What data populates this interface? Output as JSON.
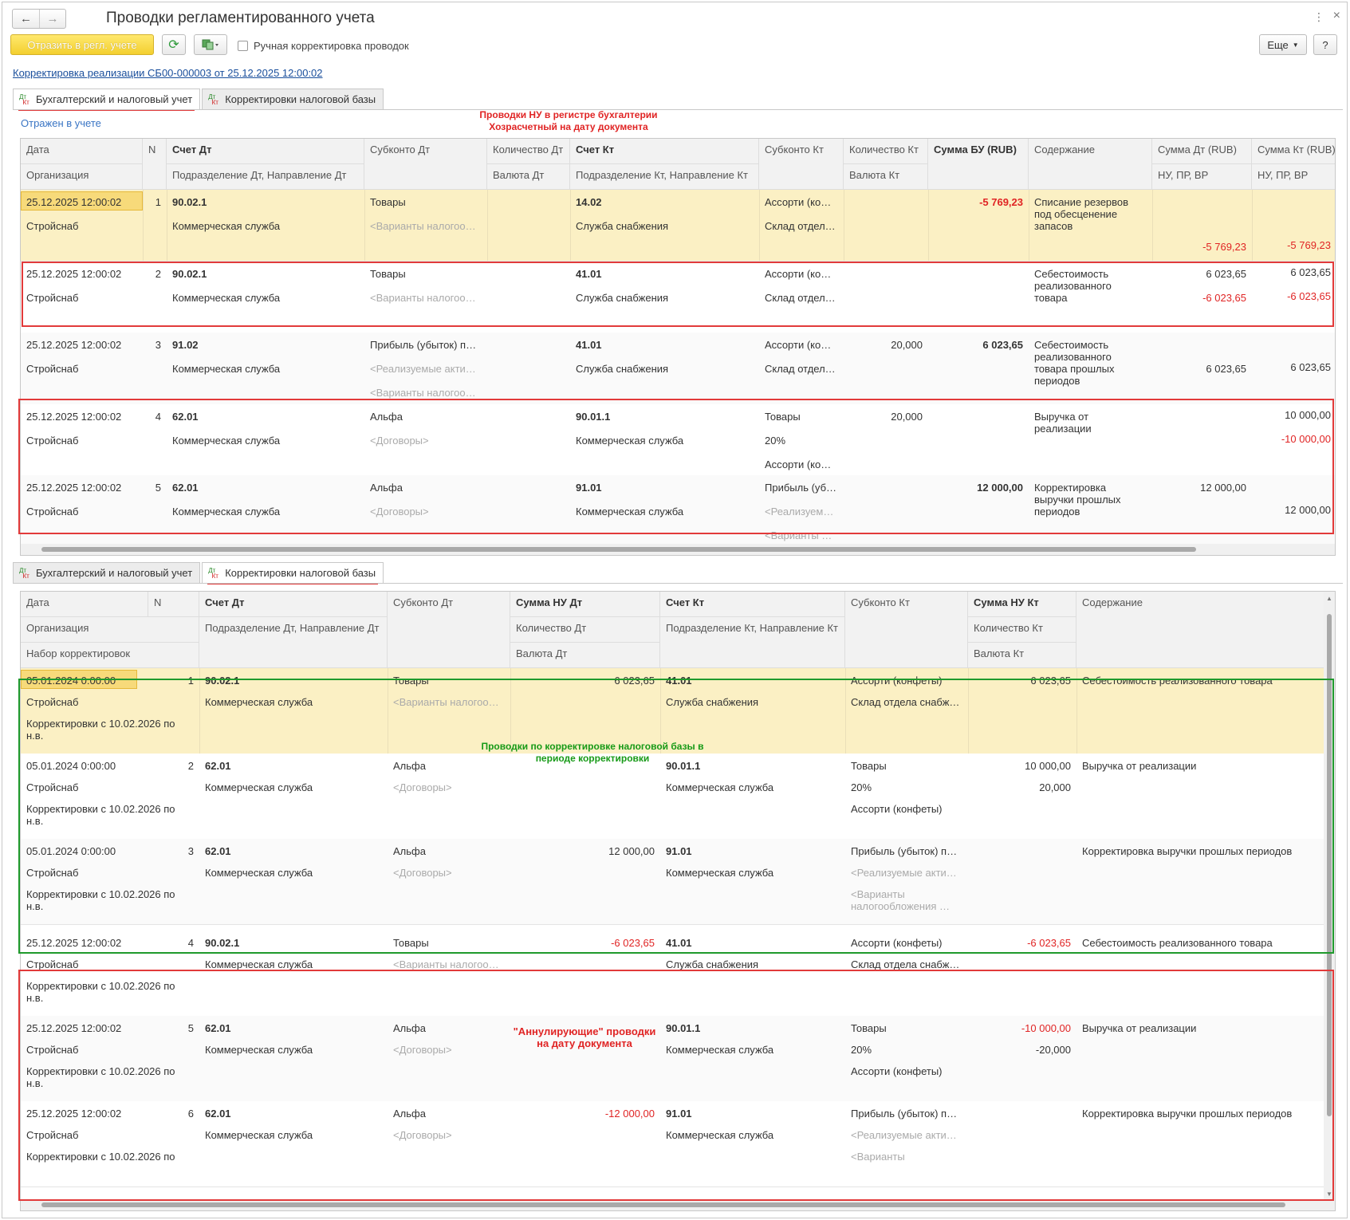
{
  "window": {
    "title": "Проводки регламентированного учета",
    "back_icon": "←",
    "forward_icon": "→",
    "menu_icon": "⋮",
    "close_icon": "×"
  },
  "toolbar": {
    "post_button": "Отразить в регл. учете",
    "refresh_icon": "⟳",
    "manual_checkbox_label": "Ручная корректировка проводок",
    "more_button": "Еще",
    "help_button": "?"
  },
  "document_link": "Корректировка реализации СБ00-000003 от 25.12.2025 12:00:02",
  "tabs": {
    "dt": "Дт",
    "kt": "Кт",
    "accounting": "Бухгалтерский и налоговый учет",
    "tax_corrections": "Корректировки налоговой базы"
  },
  "annotations": {
    "top_line1": "Проводки НУ в регистре бухгалтерии",
    "top_line2": "Хозрасчетный на дату документа",
    "green_line1": "Проводки по корректировке налоговой базы в",
    "green_line2": "периоде корректировки",
    "cancel_line1": "\"Аннулирующие\" проводки",
    "cancel_line2": "на дату документа"
  },
  "reflected_label": "Отражен в учете",
  "table1": {
    "headers": {
      "date": "Дата",
      "org": "Организация",
      "n": "N",
      "acc_dt": "Счет Дт",
      "dept_dt": "Подразделение Дт, Направление Дт",
      "sub_dt": "Субконто Дт",
      "qty_dt": "Количество Дт",
      "cur_dt": "Валюта Дт",
      "acc_kt": "Счет Кт",
      "dept_kt": "Подразделение Кт, Направление Кт",
      "sub_kt": "Субконто Кт",
      "qty_kt": "Количество Кт",
      "cur_kt": "Валюта Кт",
      "sum_bu": "Сумма БУ (RUB)",
      "content": "Содержание",
      "sum_dt": "Сумма Дт (RUB)",
      "nu_dt": "НУ, ПР, ВР",
      "sum_kt": "Сумма Кт (RUB)",
      "nu_kt": "НУ, ПР, ВР"
    },
    "rows": [
      {
        "date": "25.12.2025 12:00:02",
        "org": "Стройснаб",
        "n": "1",
        "acc_dt": "90.02.1",
        "dept_dt": "Коммерческая служба",
        "sub_dt1": "Товары",
        "sub_dt2": "<Варианты налогооб…",
        "sub_dt3": "",
        "qty_dt": "",
        "acc_kt": "14.02",
        "dept_kt": "Служба снабжения",
        "sub_kt1": "Ассорти (ко…",
        "sub_kt2": "Склад отдел…",
        "sub_kt3": "",
        "qty_kt": "",
        "sum_bu": "-5 769,23",
        "content": "Списание резервов под обесценение запасов",
        "sum_dt1": "",
        "sum_dt2": "",
        "sum_dt3": "-5 769,23",
        "sum_kt1": "",
        "sum_kt2": "",
        "sum_kt3": "-5 769,23"
      },
      {
        "date": "25.12.2025 12:00:02",
        "org": "Стройснаб",
        "n": "2",
        "acc_dt": "90.02.1",
        "dept_dt": "Коммерческая служба",
        "sub_dt1": "Товары",
        "sub_dt2": "<Варианты налогооб…",
        "sub_dt3": "",
        "qty_dt": "",
        "acc_kt": "41.01",
        "dept_kt": "Служба снабжения",
        "sub_kt1": "Ассорти (ко…",
        "sub_kt2": "Склад отдел…",
        "sub_kt3": "",
        "qty_kt": "",
        "sum_bu": "",
        "content": "Себестоимость реализованного товара",
        "sum_dt1": "6 023,65",
        "sum_dt2": "-6 023,65",
        "sum_dt3": "",
        "sum_kt1": "6 023,65",
        "sum_kt2": "-6 023,65",
        "sum_kt3": ""
      },
      {
        "date": "25.12.2025 12:00:02",
        "org": "Стройснаб",
        "n": "3",
        "acc_dt": "91.02",
        "dept_dt": "Коммерческая служба",
        "sub_dt1": "Прибыль (убыток) пр…",
        "sub_dt2": "<Реализуемые акти…",
        "sub_dt3": "<Варианты налогооб…",
        "qty_dt": "",
        "acc_kt": "41.01",
        "dept_kt": "Служба снабжения",
        "sub_kt1": "Ассорти (ко…",
        "sub_kt2": "Склад отдел…",
        "sub_kt3": "",
        "qty_kt": "20,000",
        "sum_bu": "6 023,65",
        "content": "Себестоимость реализованного товара прошлых периодов",
        "sum_dt1": "",
        "sum_dt2": "6 023,65",
        "sum_dt3": "",
        "sum_kt1": "",
        "sum_kt2": "6 023,65",
        "sum_kt3": ""
      },
      {
        "date": "25.12.2025 12:00:02",
        "org": "Стройснаб",
        "n": "4",
        "acc_dt": "62.01",
        "dept_dt": "Коммерческая служба",
        "sub_dt1": "Альфа",
        "sub_dt2": "<Договоры>",
        "sub_dt3": "",
        "qty_dt": "",
        "acc_kt": "90.01.1",
        "dept_kt": "Коммерческая служба",
        "sub_kt1": "Товары",
        "sub_kt2": "20%",
        "sub_kt3": "Ассорти (ко…",
        "qty_kt": "20,000",
        "sum_bu": "",
        "content": "Выручка от реализации",
        "sum_dt1": "",
        "sum_dt2": "",
        "sum_dt3": "",
        "sum_kt1": "10 000,00",
        "sum_kt2": "-10 000,00",
        "sum_kt3": ""
      },
      {
        "date": "25.12.2025 12:00:02",
        "org": "Стройснаб",
        "n": "5",
        "acc_dt": "62.01",
        "dept_dt": "Коммерческая служба",
        "sub_dt1": "Альфа",
        "sub_dt2": "<Договоры>",
        "sub_dt3": "",
        "qty_dt": "",
        "acc_kt": "91.01",
        "dept_kt": "Коммерческая служба",
        "sub_kt1": "Прибыль (уб…",
        "sub_kt2": "<Реализуем…",
        "sub_kt3": "<Варианты …",
        "qty_kt": "",
        "sum_bu": "12 000,00",
        "content": "Корректировка выручки прошлых периодов",
        "sum_dt1": "12 000,00",
        "sum_dt2": "",
        "sum_dt3": "",
        "sum_kt1": "",
        "sum_kt2": "12 000,00",
        "sum_kt3": ""
      }
    ]
  },
  "table2": {
    "headers": {
      "date": "Дата",
      "org": "Организация",
      "set": "Набор корректировок",
      "n": "N",
      "acc_dt": "Счет Дт",
      "dept_dt": "Подразделение Дт, Направление Дт",
      "sub_dt": "Субконто Дт",
      "sum_dt": "Сумма НУ Дт",
      "qty_dt": "Количество Дт",
      "cur_dt": "Валюта Дт",
      "acc_kt": "Счет Кт",
      "dept_kt": "Подразделение Кт, Направление Кт",
      "sub_kt": "Субконто Кт",
      "sum_kt": "Сумма НУ Кт",
      "qty_kt": "Количество Кт",
      "cur_kt": "Валюта Кт",
      "content": "Содержание"
    },
    "rows": [
      {
        "date": "05.01.2024 0:00:00",
        "org": "Стройснаб",
        "set": "Корректировки с 10.02.2026 по н.в.",
        "n": "1",
        "acc_dt": "90.02.1",
        "dept_dt": "Коммерческая служба",
        "sub_dt1": "Товары",
        "sub_dt2": "<Варианты налогооб…",
        "sub_dt3": "",
        "sum_dt": "6 023,65",
        "acc_kt": "41.01",
        "dept_kt": "Служба снабжения",
        "sub_kt1": "Ассорти (конфеты)",
        "sub_kt2": "Склад отдела снабж…",
        "sub_kt3": "",
        "sum_kt": "6 023,65",
        "qty_kt": "",
        "content": "Себестоимость реализованного товара"
      },
      {
        "date": "05.01.2024 0:00:00",
        "org": "Стройснаб",
        "set": "Корректировки с 10.02.2026 по н.в.",
        "n": "2",
        "acc_dt": "62.01",
        "dept_dt": "Коммерческая служба",
        "sub_dt1": "Альфа",
        "sub_dt2": "<Договоры>",
        "sub_dt3": "",
        "sum_dt": "",
        "acc_kt": "90.01.1",
        "dept_kt": "Коммерческая служба",
        "sub_kt1": "Товары",
        "sub_kt2": "20%",
        "sub_kt3": "Ассорти (конфеты)",
        "sum_kt": "10 000,00",
        "qty_kt": "20,000",
        "content": "Выручка от реализации"
      },
      {
        "date": "05.01.2024 0:00:00",
        "org": "Стройснаб",
        "set": "Корректировки с 10.02.2026 по н.в.",
        "n": "3",
        "acc_dt": "62.01",
        "dept_dt": "Коммерческая служба",
        "sub_dt1": "Альфа",
        "sub_dt2": "<Договоры>",
        "sub_dt3": "",
        "sum_dt": "12 000,00",
        "acc_kt": "91.01",
        "dept_kt": "Коммерческая служба",
        "sub_kt1": "Прибыль (убыток) пр…",
        "sub_kt2": "<Реализуемые акти…",
        "sub_kt3": "<Варианты налогообложения …",
        "sum_kt": "",
        "qty_kt": "",
        "content": "Корректировка выручки прошлых периодов"
      },
      {
        "date": "25.12.2025 12:00:02",
        "org": "Стройснаб",
        "set": "Корректировки с 10.02.2026 по н.в.",
        "n": "4",
        "acc_dt": "90.02.1",
        "dept_dt": "Коммерческая служба",
        "sub_dt1": "Товары",
        "sub_dt2": "<Варианты налогооб…",
        "sub_dt3": "",
        "sum_dt": "-6 023,65",
        "acc_kt": "41.01",
        "dept_kt": "Служба снабжения",
        "sub_kt1": "Ассорти (конфеты)",
        "sub_kt2": "Склад отдела снабж…",
        "sub_kt3": "",
        "sum_kt": "-6 023,65",
        "qty_kt": "",
        "content": "Себестоимость реализованного товара"
      },
      {
        "date": "25.12.2025 12:00:02",
        "org": "Стройснаб",
        "set": "Корректировки с 10.02.2026 по н.в.",
        "n": "5",
        "acc_dt": "62.01",
        "dept_dt": "Коммерческая служба",
        "sub_dt1": "Альфа",
        "sub_dt2": "<Договоры>",
        "sub_dt3": "",
        "sum_dt": "",
        "acc_kt": "90.01.1",
        "dept_kt": "Коммерческая служба",
        "sub_kt1": "Товары",
        "sub_kt2": "20%",
        "sub_kt3": "Ассорти (конфеты)",
        "sum_kt": "-10 000,00",
        "qty_kt": "-20,000",
        "content": "Выручка от реализации"
      },
      {
        "date": "25.12.2025 12:00:02",
        "org": "Стройснаб",
        "set": "Корректировки с 10.02.2026 по",
        "n": "6",
        "acc_dt": "62.01",
        "dept_dt": "Коммерческая служба",
        "sub_dt1": "Альфа",
        "sub_dt2": "<Договоры>",
        "sub_dt3": "",
        "sum_dt": "-12 000,00",
        "acc_kt": "91.01",
        "dept_kt": "Коммерческая служба",
        "sub_kt1": "Прибыль (убыток) пр…",
        "sub_kt2": "<Реализуемые акти…",
        "sub_kt3": "<Варианты",
        "sum_kt": "",
        "qty_kt": "",
        "content": "Корректировка выручки прошлых периодов"
      }
    ]
  },
  "colors": {
    "accent_red": "#e23a3a",
    "accent_green": "#1f9a2c",
    "selected_row": "#fbf0c4",
    "post_button": "#f3cf2f",
    "link": "#1a4f9c"
  }
}
